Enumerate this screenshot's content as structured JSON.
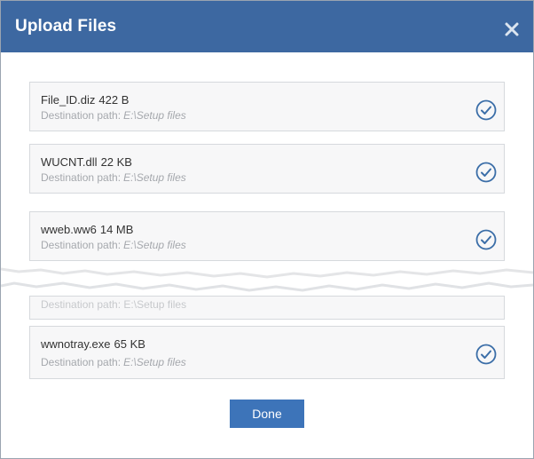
{
  "dialog": {
    "title": "Upload Files",
    "close_symbol": "×"
  },
  "files": [
    {
      "name": "File_ID.diz",
      "size": "422 B",
      "dest_label": "Destination path:",
      "dest_path": "E:\\Setup files",
      "status": "check-circle-icon"
    },
    {
      "name": "WUCNT.dll",
      "size": "22 KB",
      "dest_label": "Destination path:",
      "dest_path": "E:\\Setup files",
      "status": "check-circle-icon"
    },
    {
      "name": "wweb.ww6",
      "size": "14 MB",
      "dest_label": "Destination path:",
      "dest_path": "E:\\Setup files",
      "status": "check-circle-icon"
    },
    {
      "name": "wwnotray.exe",
      "size": "65 KB",
      "dest_label": "Destination path:",
      "dest_path": "E:\\Setup files",
      "status": "check-circle-icon"
    }
  ],
  "partial_row": {
    "text": "Destination path: E:\\Setup files"
  },
  "footer": {
    "done_label": "Done"
  },
  "colors": {
    "header_bg": "#3d68a1",
    "button_bg": "#3d74b9",
    "check_color": "#3b6ea8"
  }
}
